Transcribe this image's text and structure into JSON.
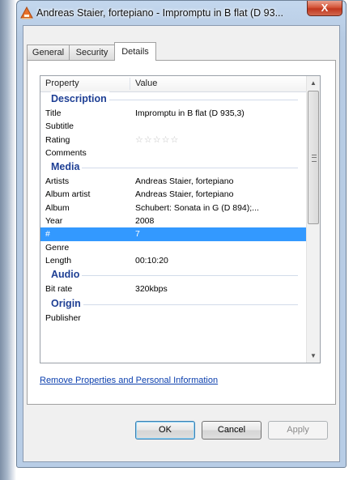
{
  "window": {
    "title": "Andreas Staier, fortepiano - Impromptu in B flat (D 93...",
    "close_label": "X"
  },
  "tabs": [
    {
      "label": "General"
    },
    {
      "label": "Security"
    },
    {
      "label": "Details"
    }
  ],
  "list": {
    "header_property": "Property",
    "header_value": "Value",
    "groups": {
      "description": "Description",
      "media": "Media",
      "audio": "Audio",
      "origin": "Origin"
    },
    "rows": {
      "title": {
        "p": "Title",
        "v": "Impromptu in B flat (D 935,3)"
      },
      "subtitle": {
        "p": "Subtitle",
        "v": ""
      },
      "rating": {
        "p": "Rating",
        "stars": "☆☆☆☆☆",
        "value": 0
      },
      "comments": {
        "p": "Comments",
        "v": ""
      },
      "artists": {
        "p": "Artists",
        "v": "Andreas Staier, fortepiano"
      },
      "album_artist": {
        "p": "Album artist",
        "v": "Andreas Staier, fortepiano"
      },
      "album": {
        "p": "Album",
        "v": "Schubert: Sonata in G (D 894);..."
      },
      "year": {
        "p": "Year",
        "v": "2008"
      },
      "track": {
        "p": "#",
        "v": "7"
      },
      "genre": {
        "p": "Genre",
        "v": ""
      },
      "length": {
        "p": "Length",
        "v": "00:10:20"
      },
      "bitrate": {
        "p": "Bit rate",
        "v": "320kbps"
      },
      "publisher": {
        "p": "Publisher",
        "v": ""
      }
    }
  },
  "link": {
    "label": "Remove Properties and Personal Information"
  },
  "buttons": {
    "ok": "OK",
    "cancel": "Cancel",
    "apply": "Apply"
  },
  "icons": {
    "app": "media-file-icon",
    "close": "close-icon",
    "scroll_up": "chevron-up-icon",
    "scroll_down": "chevron-down-icon"
  },
  "colors": {
    "selection": "#3399ff",
    "group_header": "#1e3f94",
    "link": "#0b3fae",
    "close_button": "#c0371e"
  }
}
